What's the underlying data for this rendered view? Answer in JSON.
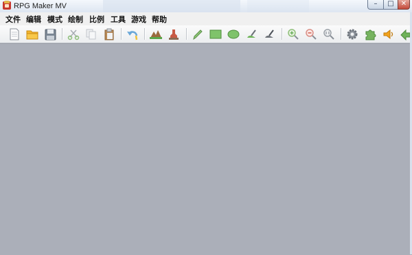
{
  "window": {
    "title": "RPG Maker MV",
    "minimize": "–",
    "maximize": "□",
    "close": "✕"
  },
  "menu": [
    "文件",
    "编辑",
    "模式",
    "绘制",
    "比例",
    "工具",
    "游戏",
    "帮助"
  ],
  "toolbar": [
    {
      "name": "new-project",
      "icon": "document-icon"
    },
    {
      "name": "open-project",
      "icon": "folder-icon"
    },
    {
      "name": "save-project",
      "icon": "floppy-icon"
    },
    {
      "name": "cut",
      "icon": "scissors-icon"
    },
    {
      "name": "copy",
      "icon": "copy-icon"
    },
    {
      "name": "paste",
      "icon": "clipboard-icon"
    },
    {
      "name": "undo",
      "icon": "undo-arrow-icon"
    },
    {
      "name": "map-mode",
      "icon": "mountain-icon"
    },
    {
      "name": "event-mode",
      "icon": "stamp-icon"
    },
    {
      "name": "pencil-tool",
      "icon": "pencil-icon"
    },
    {
      "name": "rectangle-tool",
      "icon": "rectangle-icon"
    },
    {
      "name": "ellipse-tool",
      "icon": "ellipse-icon"
    },
    {
      "name": "fill-tool",
      "icon": "fill-icon"
    },
    {
      "name": "shadow-pen-tool",
      "icon": "shadow-pen-icon"
    },
    {
      "name": "zoom-in",
      "icon": "zoom-in-icon"
    },
    {
      "name": "zoom-out",
      "icon": "zoom-out-icon"
    },
    {
      "name": "zoom-actual",
      "icon": "zoom-1to1-icon"
    },
    {
      "name": "database",
      "icon": "gear-icon"
    },
    {
      "name": "plugin-manager",
      "icon": "puzzle-icon"
    },
    {
      "name": "sound-test",
      "icon": "speaker-icon"
    },
    {
      "name": "more",
      "icon": "arrow-icon"
    }
  ],
  "colors": {
    "workspace": "#abafb9",
    "icon_green": "#5aa64a",
    "icon_orange": "#f1a21c",
    "icon_gray": "#8d939b"
  }
}
